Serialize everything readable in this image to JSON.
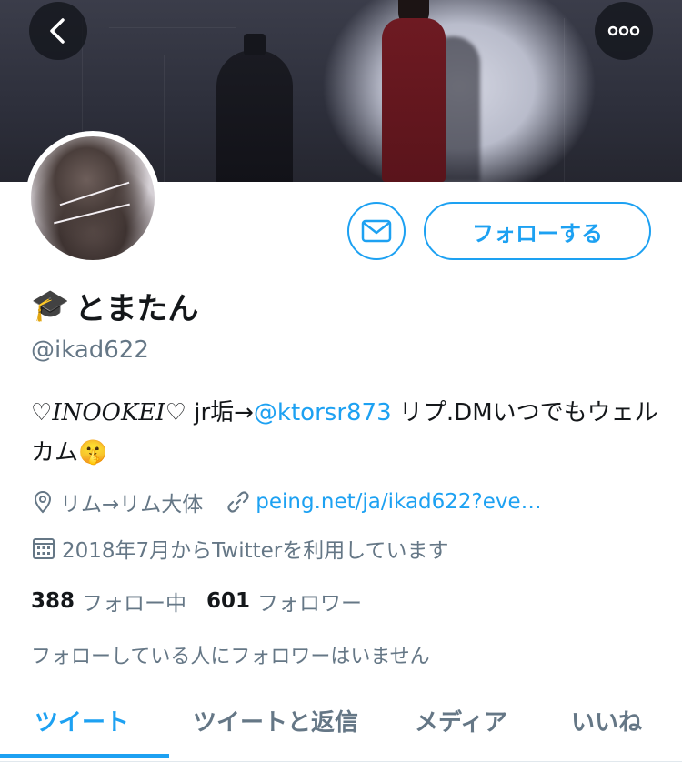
{
  "header": {
    "back_icon": "chevron-left-icon",
    "more_icon": "more-horizontal-icon"
  },
  "profile": {
    "name_emoji": "🎓",
    "name": "とまたん",
    "handle": "@ikad622",
    "bio_part1": "♡",
    "bio_italic": "INOOKEI",
    "bio_part2": "♡ jr垢→",
    "bio_mention": "@ktorsr873",
    "bio_part3": " リプ.DMいつでもウェルカム",
    "bio_emoji": "🤫",
    "location": "リム→リム大体",
    "website": "peing.net/ja/ikad622?eve…",
    "joined": "2018年7月からTwitterを利用しています",
    "following_count": "388",
    "following_label": "フォロー中",
    "followers_count": "601",
    "followers_label": "フォロワー",
    "no_followers_you_know": "フォローしている人にフォロワーはいません"
  },
  "actions": {
    "follow_label": "フォローする",
    "dm_icon": "envelope-icon"
  },
  "tabs": [
    {
      "label": "ツイート",
      "active": true
    },
    {
      "label": "ツイートと返信",
      "active": false
    },
    {
      "label": "メディア",
      "active": false
    },
    {
      "label": "いいね",
      "active": false
    }
  ],
  "colors": {
    "accent": "#1da1f2",
    "secondary_text": "#657786",
    "primary_text": "#14171a"
  }
}
